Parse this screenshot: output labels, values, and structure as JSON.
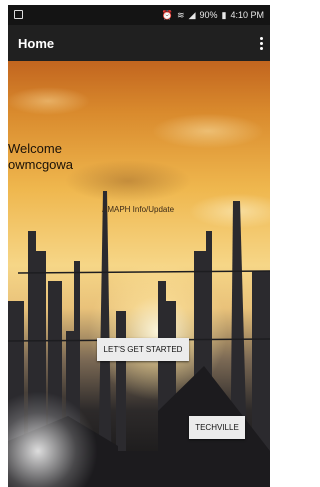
{
  "status_bar": {
    "icons": [
      "image-icon",
      "alarm-icon",
      "wifi-icon",
      "signal-icon",
      "battery-icon"
    ],
    "battery": "90%",
    "time": "4:10 PM"
  },
  "app_bar": {
    "title": "Home",
    "menu_icon": "overflow-menu-icon"
  },
  "main": {
    "welcome_line1": "Welcome",
    "welcome_line2": "owmcgowa",
    "info_link": "AMAPH Info/Update",
    "get_started_label": "LET'S GET STARTED",
    "techville_label": "TECHVILLE"
  },
  "colors": {
    "app_bar": "#202020",
    "status_bar": "#141414",
    "button_bg": "#ececec"
  }
}
